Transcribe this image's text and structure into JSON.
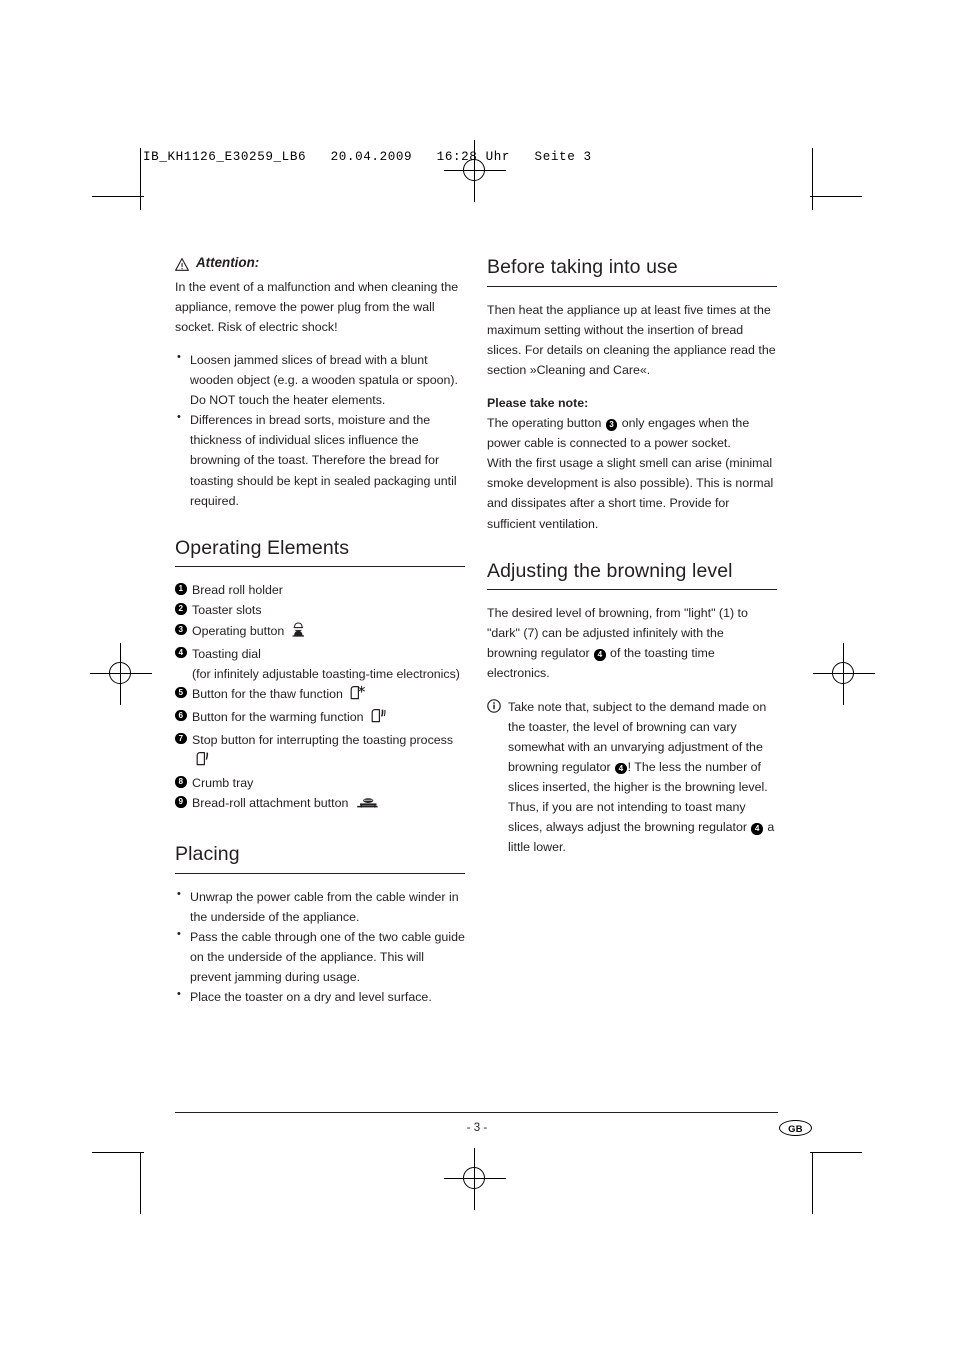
{
  "print_header": "IB_KH1126_E30259_LB6   20.04.2009   16:28 Uhr   Seite 3",
  "left_column": {
    "attention": {
      "icon": "warning-triangle-icon",
      "heading": "Attention:",
      "paragraph": "In the event of a malfunction and when cleaning the appliance, remove the power plug from the wall socket. Risk of electric shock!",
      "bullets": [
        "Loosen jammed slices of bread with a blunt wooden object (e.g. a wooden spatula or spoon). Do NOT touch the heater elements.",
        "Differences in bread sorts, moisture and the thickness of individual slices influence the browning of the toast. Therefore the bread for toasting should be kept in sealed packaging until required."
      ]
    },
    "operating_elements": {
      "heading": "Operating Elements",
      "items": [
        {
          "num": "1",
          "label": "Bread roll holder",
          "icon": null
        },
        {
          "num": "2",
          "label": "Toaster slots",
          "icon": null
        },
        {
          "num": "3",
          "label": "Operating button",
          "icon": "operating-button-icon"
        },
        {
          "num": "4",
          "label": "Toasting dial",
          "icon": null,
          "sub": "(for infinitely adjustable toasting-time electronics)"
        },
        {
          "num": "5",
          "label": "Button for the thaw function",
          "icon": "thaw-function-icon"
        },
        {
          "num": "6",
          "label": "Button for the warming function",
          "icon": "warming-function-icon"
        },
        {
          "num": "7",
          "label": "Stop button for interrupting the toasting process",
          "icon": "stop-button-icon"
        },
        {
          "num": "8",
          "label": "Crumb tray",
          "icon": null
        },
        {
          "num": "9",
          "label": "Bread-roll attachment button",
          "icon": "bread-roll-attachment-icon"
        }
      ]
    },
    "placing": {
      "heading": "Placing",
      "bullets": [
        "Unwrap the power cable from the cable winder in the underside of the appliance.",
        "Pass the cable through one of the two cable guide on the underside of the appliance. This will prevent jamming during usage.",
        "Place the toaster on a dry and level surface."
      ]
    }
  },
  "right_column": {
    "before_use": {
      "heading": "Before taking into use",
      "paragraph": "Then heat the appliance up at least five times at the maximum setting without the insertion of bread slices. For details on cleaning the appliance read the section »Cleaning and Care«.",
      "note_heading": "Please take note:",
      "note_part1": "The operating button",
      "note_ref1": "3",
      "note_part2": "only engages when the power cable is connected to a power socket.",
      "note_part3": "With the first usage a slight smell can arise (minimal smoke development is also possible). This is normal and dissipates after a short time. Provide for sufficient ventilation."
    },
    "browning": {
      "heading": "Adjusting the browning level",
      "intro_part1": "The desired level of browning, from \"light\" (1) to \"dark\" (7) can be adjusted infinitely with the browning regulator",
      "intro_ref": "4",
      "intro_part2": "of the toasting time electronics.",
      "info_icon": "info-circle-icon",
      "info_part1": "Take note that, subject to the demand made on the toaster, the level of browning can vary somewhat with an unvarying adjustment of the browning regulator",
      "info_ref1": "4",
      "info_part2": "! The less the number of slices inserted, the higher is the browning level. Thus, if you are not intending to toast many slices, always adjust the browning regulator",
      "info_ref2": "4",
      "info_part3": "a little lower."
    }
  },
  "footer": {
    "page_number": "- 3 -",
    "language_badge": "GB"
  }
}
